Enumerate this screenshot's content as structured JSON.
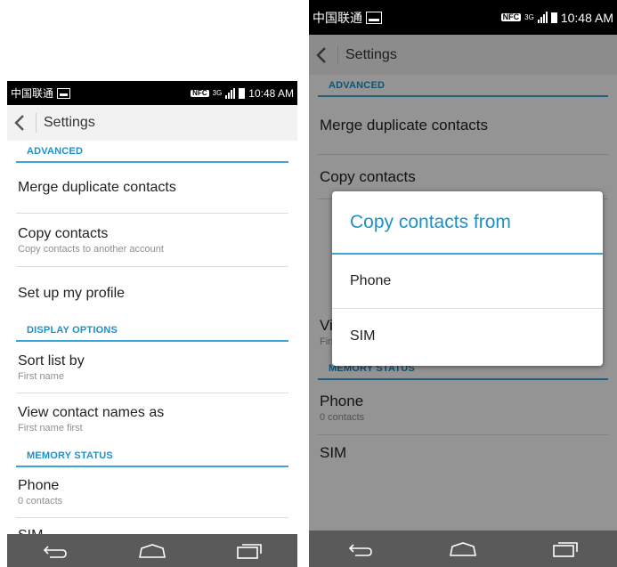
{
  "status_bar": {
    "carrier": "中国联通",
    "nfc": "NFC",
    "network": "3G",
    "time": "10:48 AM"
  },
  "app_bar": {
    "title": "Settings"
  },
  "settings": {
    "advanced_header": "ADVANCED",
    "merge": {
      "title": "Merge duplicate contacts"
    },
    "copy": {
      "title": "Copy contacts",
      "subtitle": "Copy contacts to another account"
    },
    "profile": {
      "title": "Set up my profile"
    },
    "display_header": "DISPLAY OPTIONS",
    "sort": {
      "title": "Sort list by",
      "subtitle": "First name"
    },
    "view_names": {
      "title": "View contact names as",
      "subtitle": "First name first"
    },
    "memory_header": "MEMORY STATUS",
    "phone": {
      "title": "Phone",
      "subtitle": "0 contacts"
    },
    "sim": {
      "title": "SIM"
    }
  },
  "dialog": {
    "title": "Copy contacts from",
    "options": [
      "Phone",
      "SIM"
    ]
  },
  "icons": {
    "back": "chevron-left-icon",
    "nav_back": "back-arrow-icon",
    "nav_home": "home-icon",
    "nav_recent": "recent-apps-icon"
  }
}
